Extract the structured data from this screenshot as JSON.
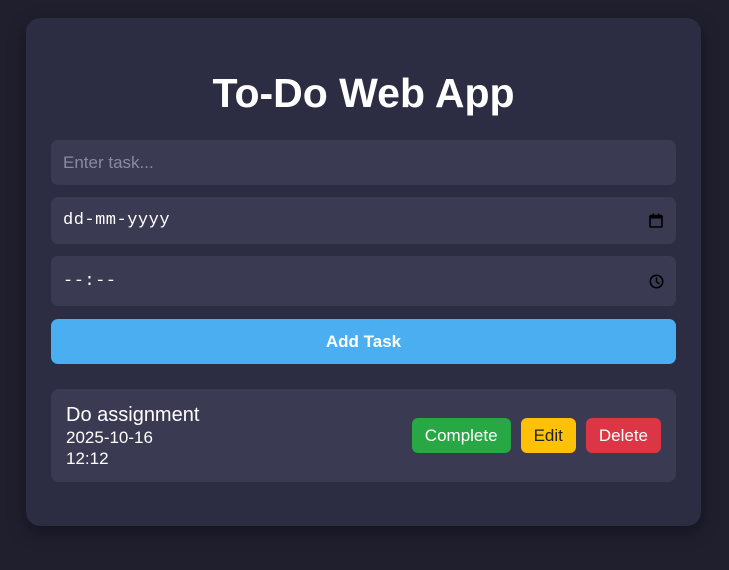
{
  "app": {
    "title": "To-Do Web App"
  },
  "form": {
    "task_placeholder": "Enter task...",
    "task_value": "",
    "date_placeholder": "dd-mm-yyyy",
    "date_icon": "calendar-icon",
    "time_placeholder": "--:--",
    "time_icon": "clock-icon",
    "add_label": "Add Task",
    "add_color": "#4aaef0"
  },
  "tasks": [
    {
      "name": "Do assignment",
      "date": "2025-10-16",
      "time": "12:12",
      "actions": {
        "complete_label": "Complete",
        "edit_label": "Edit",
        "delete_label": "Delete"
      }
    }
  ],
  "colors": {
    "background": "#1f1f2e",
    "card": "#2c2c43",
    "field": "#3a3a52",
    "complete": "#28a745",
    "edit": "#ffc107",
    "delete": "#dc3545"
  }
}
